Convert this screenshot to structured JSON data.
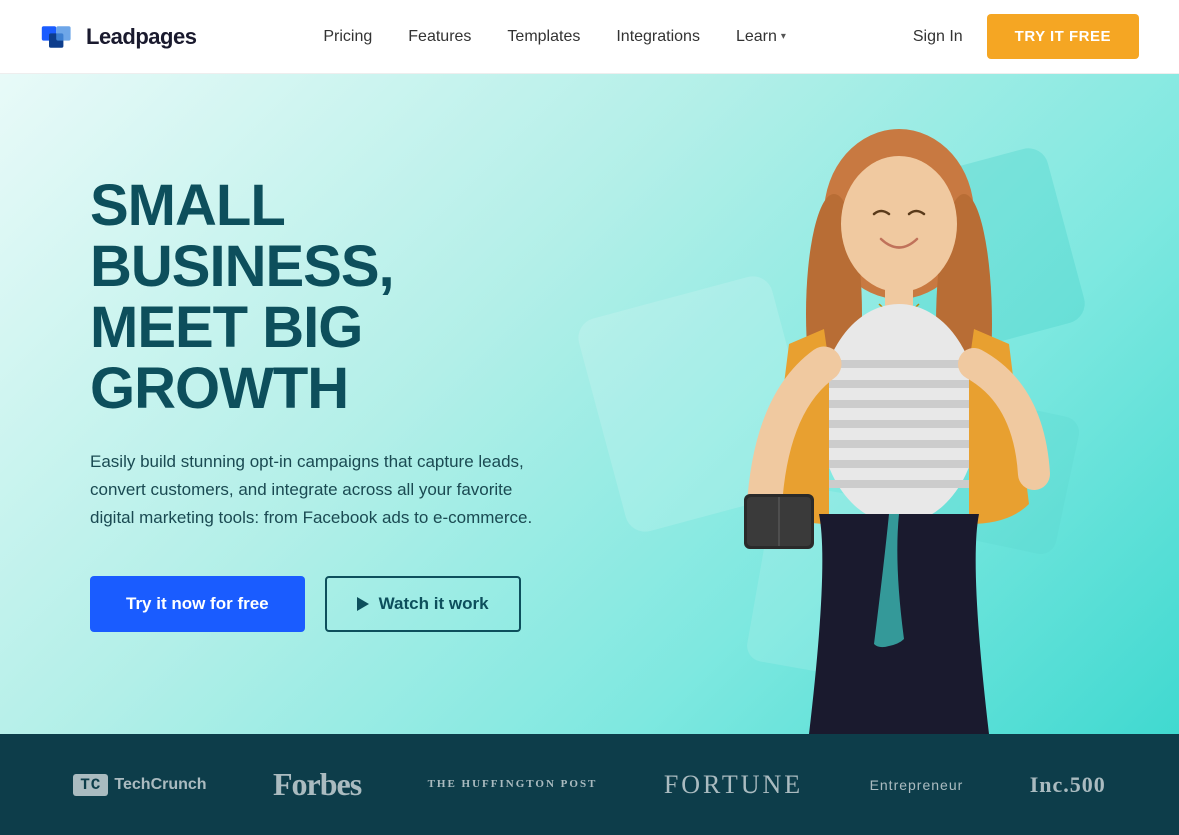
{
  "navbar": {
    "logo_text": "Leadpages",
    "nav_items": [
      {
        "label": "Pricing",
        "id": "pricing"
      },
      {
        "label": "Features",
        "id": "features"
      },
      {
        "label": "Templates",
        "id": "templates"
      },
      {
        "label": "Integrations",
        "id": "integrations"
      },
      {
        "label": "Learn",
        "id": "learn",
        "has_dropdown": true
      }
    ],
    "sign_in_label": "Sign In",
    "cta_label": "TRY IT FREE"
  },
  "hero": {
    "headline_line1": "SMALL BUSINESS,",
    "headline_line2": "MEET BIG GROWTH",
    "subheadline": "Easily build stunning opt-in campaigns that capture leads, convert customers, and integrate across all your favorite digital marketing tools: from Facebook ads to e-commerce.",
    "cta_primary": "Try it now for free",
    "cta_secondary": "Watch it work"
  },
  "press_bar": {
    "logos": [
      {
        "name": "TechCrunch",
        "id": "techcrunch"
      },
      {
        "name": "Forbes",
        "id": "forbes"
      },
      {
        "name": "THE HUFFINGTON POST",
        "id": "huffpost"
      },
      {
        "name": "FORTUNE",
        "id": "fortune"
      },
      {
        "name": "Entrepreneur",
        "id": "entrepreneur"
      },
      {
        "name": "Inc.500",
        "id": "inc500"
      }
    ]
  },
  "icons": {
    "play": "▶",
    "chevron_down": "▾",
    "logo_icon": "◈"
  }
}
